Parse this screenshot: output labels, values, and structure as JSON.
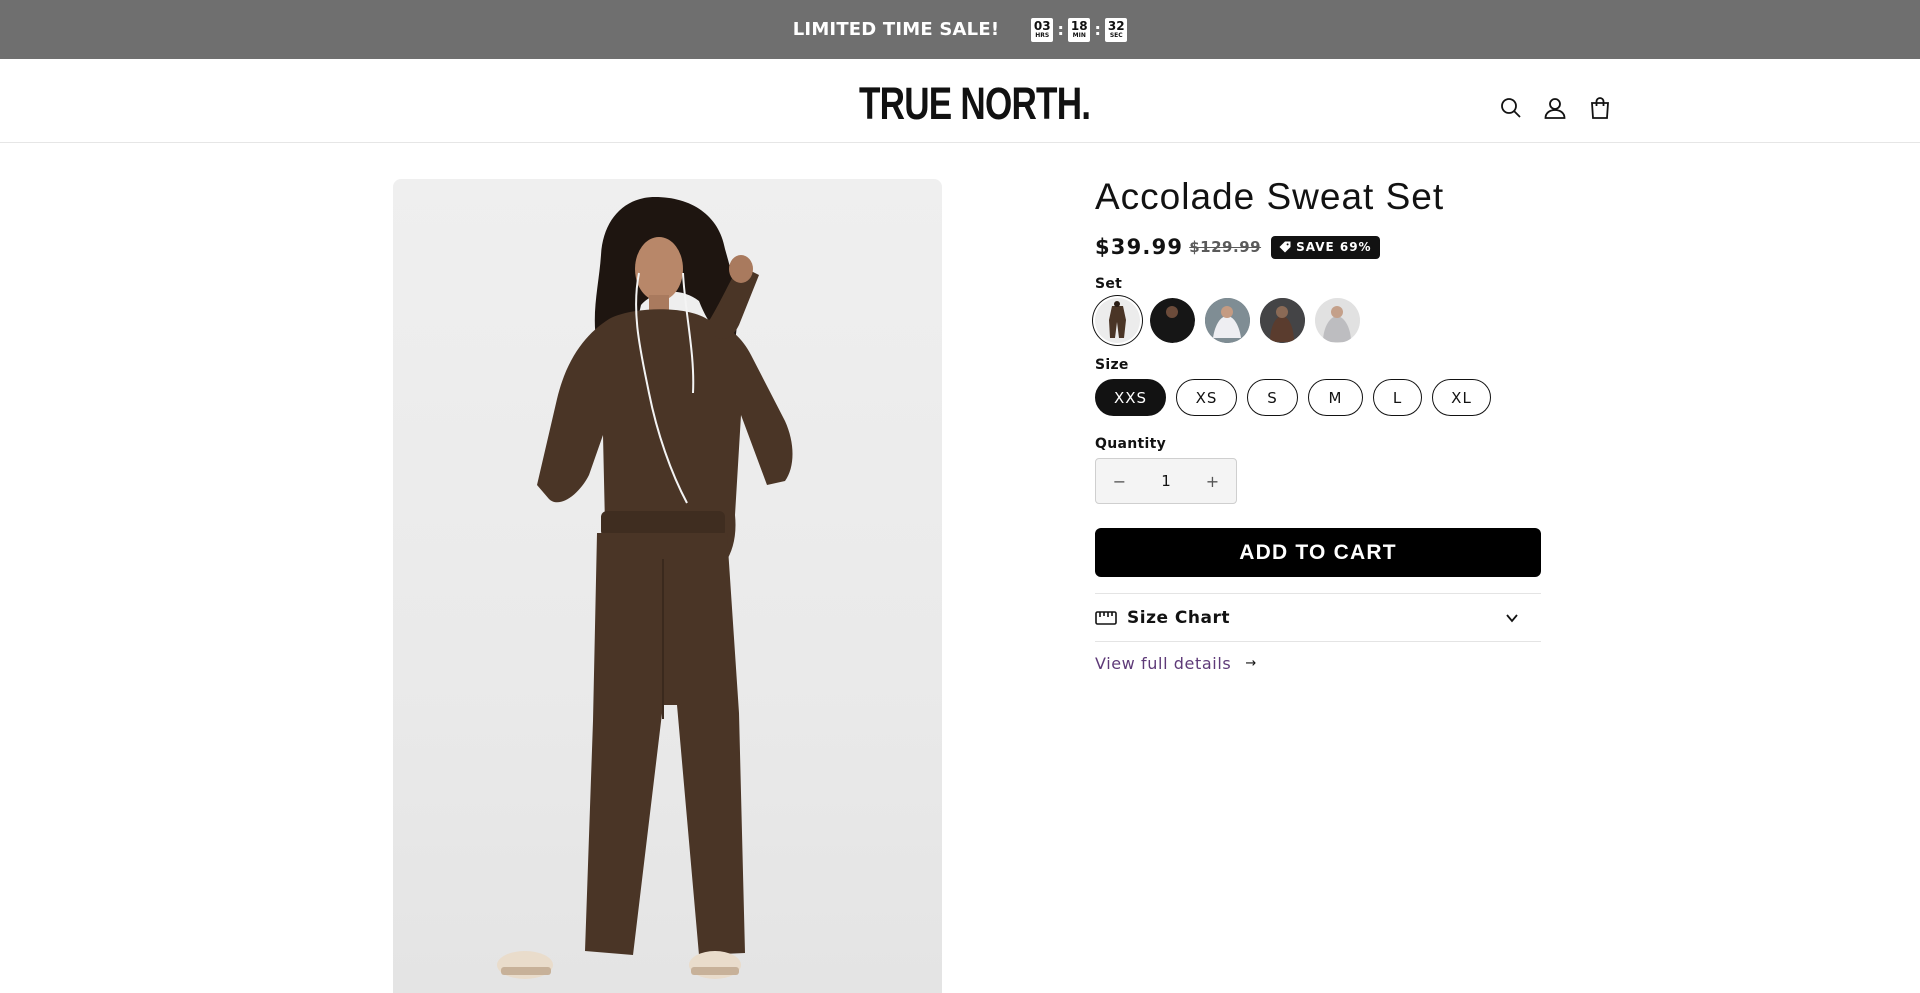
{
  "announcement": {
    "text": "LIMITED TIME SALE!",
    "timer": [
      {
        "value": "03",
        "unit": "HRS"
      },
      {
        "value": "18",
        "unit": "MIN"
      },
      {
        "value": "32",
        "unit": "SEC"
      }
    ],
    "separator": ":"
  },
  "header": {
    "logo": "TRUE NORTH.",
    "icons": [
      "search-icon",
      "account-icon",
      "cart-icon"
    ]
  },
  "product": {
    "title": "Accolade Sweat Set",
    "price": "$39.99",
    "compare_price": "$129.99",
    "badge": "SAVE 69%",
    "set_label": "Set",
    "swatches": [
      {
        "name": "Espresso",
        "color": "#4a3526",
        "selected": true
      },
      {
        "name": "Black",
        "color": "#161616",
        "selected": false
      },
      {
        "name": "White",
        "color": "#e6e6ea",
        "selected": false
      },
      {
        "name": "Charcoal",
        "color": "#3e3e40",
        "selected": false
      },
      {
        "name": "Heather Grey",
        "color": "#c9c9cb",
        "selected": false
      }
    ],
    "size_label": "Size",
    "sizes": [
      "XXS",
      "XS",
      "S",
      "M",
      "L",
      "XL"
    ],
    "selected_size": "XXS",
    "quantity_label": "Quantity",
    "quantity": "1",
    "minus": "−",
    "plus": "+",
    "add_to_cart": "ADD TO CART",
    "size_chart_label": "Size Chart",
    "view_details": "View full details",
    "view_details_arrow": "→"
  },
  "colors": {
    "announcement_bg": "#6f6f6f",
    "accent": "#121212",
    "link": "#5e3a78"
  }
}
